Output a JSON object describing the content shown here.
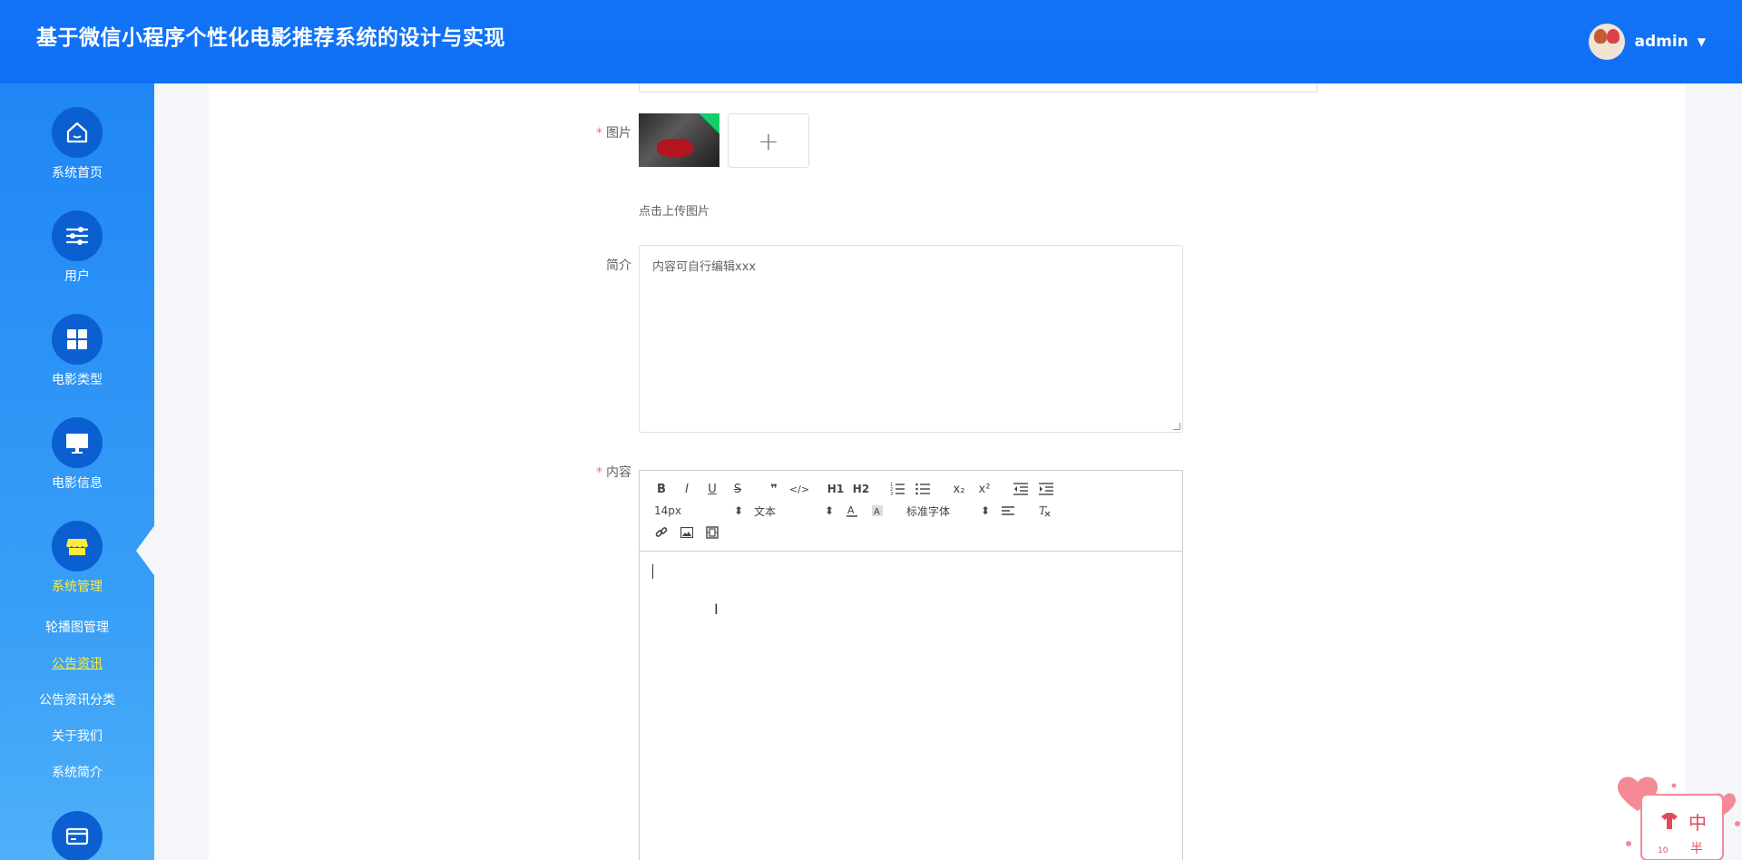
{
  "header": {
    "title": "基于微信小程序个性化电影推荐系统的设计与实现",
    "user": "admin"
  },
  "sidebar": {
    "items": [
      {
        "label": "系统首页",
        "icon": "home-icon"
      },
      {
        "label": "用户",
        "icon": "sliders-icon"
      },
      {
        "label": "电影类型",
        "icon": "grid-icon"
      },
      {
        "label": "电影信息",
        "icon": "monitor-icon"
      },
      {
        "label": "系统管理",
        "icon": "shop-icon",
        "active": true
      }
    ],
    "subitems": [
      "轮播图管理",
      "公告资讯",
      "公告资讯分类",
      "关于我们",
      "系统简介"
    ],
    "active_subitem": "公告资讯",
    "bottom_icon": "card-icon"
  },
  "form": {
    "image_label": "图片",
    "upload_hint": "点击上传图片",
    "upload_plus": "+",
    "intro_label": "简介",
    "intro_value": "内容可自行编辑xxx",
    "content_label": "内容",
    "required_mark": "*"
  },
  "editor": {
    "row1": [
      "B",
      "I",
      "U",
      "S",
      "❞",
      "</>",
      "H1",
      "H2",
      "ol",
      "ul",
      "x₂",
      "x²",
      "outdent",
      "indent"
    ],
    "font_size": "14px",
    "block_type": "文本",
    "font_family": "标准字体",
    "select_arrow": "⬍"
  },
  "mascot": {
    "text1": "中",
    "text2": "半",
    "text3": "10"
  },
  "colors": {
    "primary": "#1274f6",
    "active_nav": "#ffeb3b",
    "required": "#f56c6c"
  }
}
